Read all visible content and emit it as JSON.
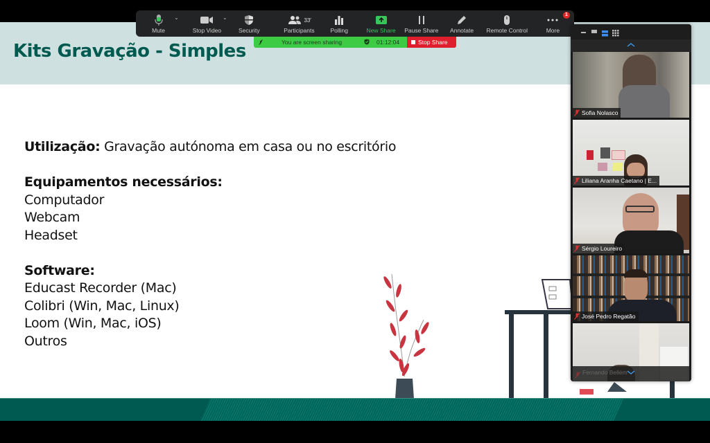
{
  "slide": {
    "title": "Kits Gravação - Simples",
    "usage_label": "Utilização:",
    "usage_text": " Gravação autónoma em casa ou no escritório",
    "equipment_heading": "Equipamentos necessários:",
    "equipment": [
      "Computador",
      "Webcam",
      "Headset"
    ],
    "software_heading": "Software:",
    "software": [
      "Educast Recorder (Mac)",
      "Colibri (Win, Mac, Linux)",
      "Loom (Win, Mac, iOS)",
      "Outros"
    ],
    "colors": {
      "title": "#005a4f",
      "header_bg": "#cfe0e0",
      "footer": "#005a52",
      "plant": "#c8343f"
    }
  },
  "toolbar": {
    "items": [
      {
        "label": "Mute",
        "icon": "microphone-icon",
        "has_caret": true
      },
      {
        "label": "Stop Video",
        "icon": "video-camera-icon",
        "has_caret": true
      },
      {
        "label": "Security",
        "icon": "shield-icon",
        "has_caret": false
      },
      {
        "label": "Participants",
        "icon": "participants-icon",
        "count": "33",
        "has_caret": true
      },
      {
        "label": "Polling",
        "icon": "bar-chart-icon",
        "has_caret": false
      },
      {
        "label": "New Share",
        "icon": "share-up-arrow-icon",
        "has_caret": false
      },
      {
        "label": "Pause Share",
        "icon": "pause-icon",
        "has_caret": false
      },
      {
        "label": "Annotate",
        "icon": "pencil-icon",
        "has_caret": false
      },
      {
        "label": "Remote Control",
        "icon": "mouse-icon",
        "has_caret": false
      },
      {
        "label": "More",
        "icon": "more-dots-icon",
        "badge": "1",
        "has_caret": false
      }
    ],
    "caret": "⌄"
  },
  "share_bar": {
    "status": "You are screen sharing",
    "timer": "01:12:04",
    "stop_label": "Stop Share"
  },
  "video_panel": {
    "participants": [
      {
        "name": "Sofia Nolasco",
        "muted": true
      },
      {
        "name": "Liliana Aranha Caetano | E...",
        "muted": true
      },
      {
        "name": "Sérgio Loureiro",
        "muted": true
      },
      {
        "name": "José Pedro Regatão",
        "muted": true
      },
      {
        "name": "Fernando Bellém",
        "muted": true
      }
    ]
  }
}
